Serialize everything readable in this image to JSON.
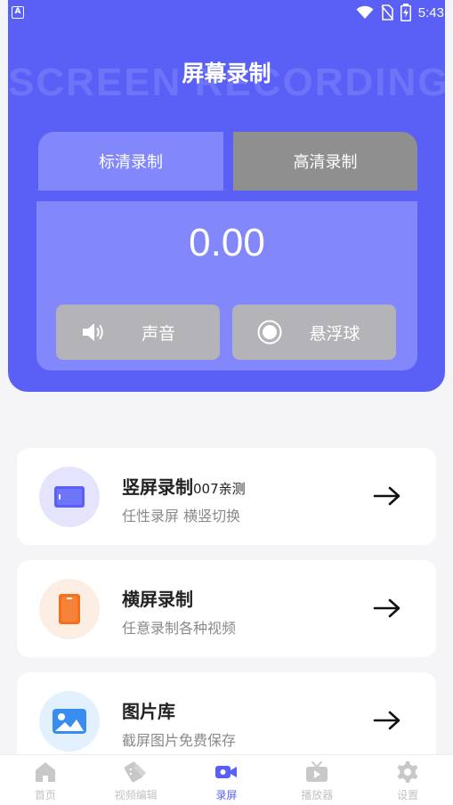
{
  "status_bar": {
    "time": "5:43",
    "left_icon_glyph": "A"
  },
  "header": {
    "watermark": "SCREEN RECORDING",
    "title": "屏幕录制",
    "tabs": [
      {
        "label": "标清录制",
        "selected": true
      },
      {
        "label": "高清录制",
        "selected": false
      }
    ],
    "timer": "0.00",
    "toggles": [
      {
        "label": "声音",
        "icon": "speaker-icon"
      },
      {
        "label": "悬浮球",
        "icon": "radio-circle-icon"
      }
    ]
  },
  "cards": [
    {
      "title": "竖屏录制",
      "title_suffix": "007亲测",
      "subtitle": "任性录屏 横竖切换",
      "icon": "landscape-screen-icon",
      "icon_color": "#5a60f6",
      "circle_color": "#e4e5fd"
    },
    {
      "title": "横屏录制",
      "title_suffix": "",
      "subtitle": "任意录制各种视频",
      "icon": "portrait-phone-icon",
      "icon_color": "#f5701b",
      "circle_color": "#fdeee3"
    },
    {
      "title": "图片库",
      "title_suffix": "",
      "subtitle": "截屏图片免费保存",
      "icon": "image-gallery-icon",
      "icon_color": "#3a8df0",
      "circle_color": "#e3f0fd"
    }
  ],
  "nav": [
    {
      "label": "首页",
      "icon": "home-icon",
      "active": false
    },
    {
      "label": "视频编辑",
      "icon": "video-edit-icon",
      "active": false
    },
    {
      "label": "录屏",
      "icon": "video-camera-icon",
      "active": true
    },
    {
      "label": "播放器",
      "icon": "tv-player-icon",
      "active": false
    },
    {
      "label": "设置",
      "icon": "gear-icon",
      "active": false
    }
  ],
  "colors": {
    "primary": "#5a60f6",
    "primary_light": "#8287fb",
    "tab_inactive": "#8f8f8f",
    "toggle_bg": "#b4b4b8",
    "background": "#f5f5f7"
  }
}
